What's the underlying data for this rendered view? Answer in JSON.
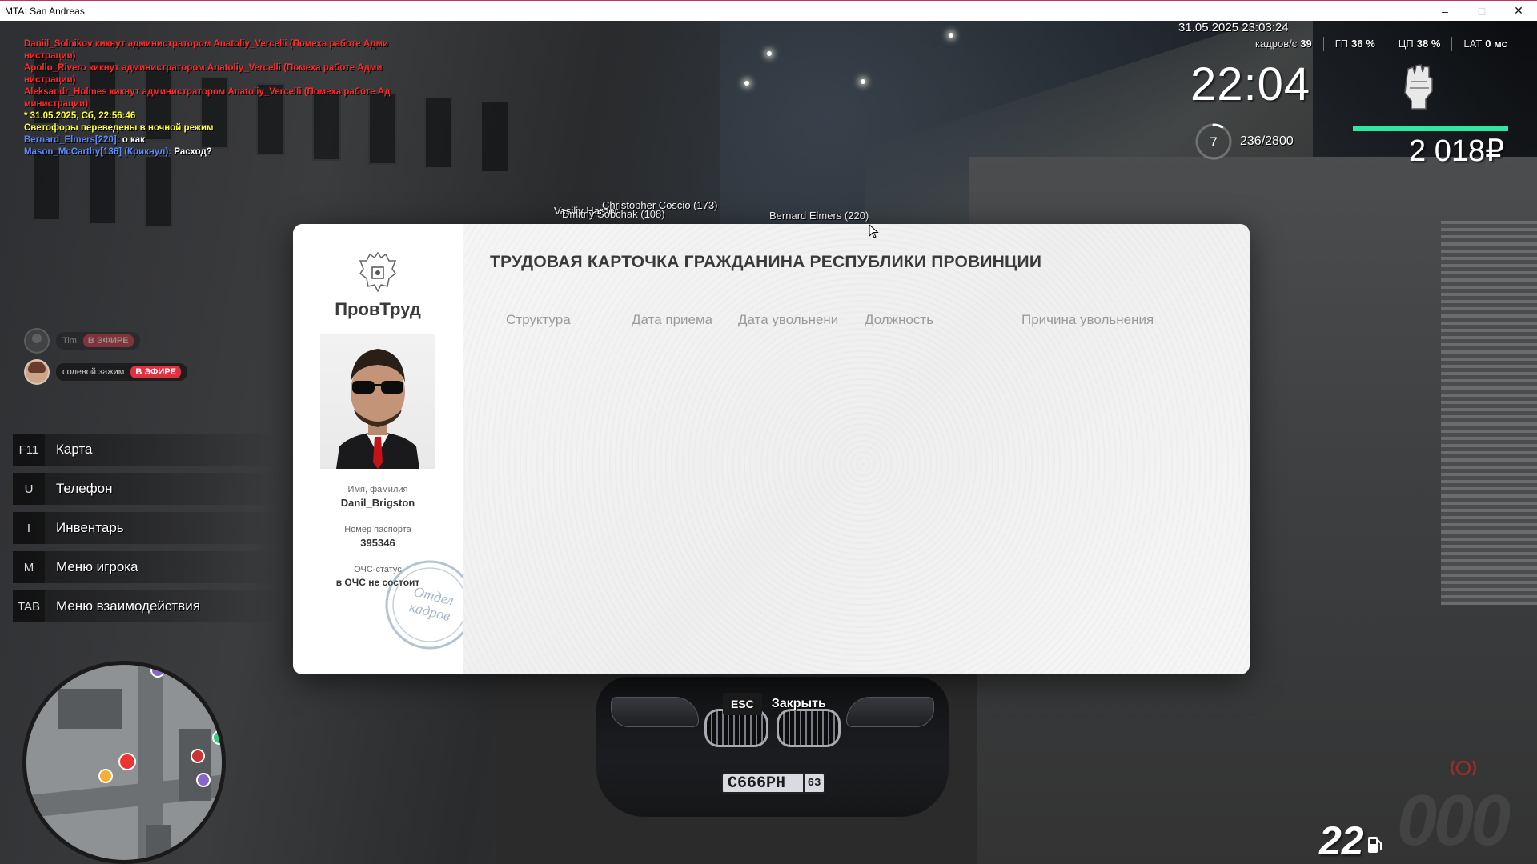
{
  "window": {
    "title": "MTA: San Andreas",
    "minimize": "–",
    "maximize": "□",
    "close": "✕"
  },
  "chat": [
    {
      "color": "red",
      "text": "Daniil_Solnikov кикнут администратором Anatoliy_Vercelli (Помеха работе Адми нистрации)"
    },
    {
      "color": "red",
      "text": "Apollo_Rivero кикнут администратором Anatoliy_Vercelli (Помеха работе Адми нистрации)"
    },
    {
      "color": "red",
      "text": "Aleksandr_Holmes кикнут администратором Anatoliy_Vercelli (Помеха работе Ад министрации)"
    },
    {
      "color": "yellow",
      "text": "* 31.05.2025, Сб, 22:56:46"
    },
    {
      "color": "yellow",
      "text": "Светофоры переведены в ночной режим"
    },
    {
      "color": "blue",
      "text": "Bernard_Elmers[220]:",
      "rest": " о как"
    },
    {
      "color": "blue",
      "text": "Mason_McCarthy[136] (Крикнул):",
      "rest": " Расход?"
    }
  ],
  "hud": {
    "datetime": "31.05.2025 23:03:24",
    "fps_label": "кадров/с",
    "fps": "39",
    "gpu_label": "ГП",
    "gpu": "36 %",
    "cpu_label": "ЦП",
    "cpu": "38 %",
    "lat_label": "LAT",
    "lat": "0 мс",
    "clock": "22:04",
    "level": "7",
    "xp": "236/2800",
    "xp_fraction": 0.084,
    "health_fraction": 1.0,
    "money": "2 018₽",
    "accent": "#2ee8a0"
  },
  "nametags": [
    {
      "text": "Christopher Coscio (173)"
    },
    {
      "text": "Vasiliy Harper"
    },
    {
      "text": "Dmitriy Sobchak (108)"
    },
    {
      "text": "Bernard Elmers (220)"
    }
  ],
  "voice": [
    {
      "name": "Tim",
      "live": "В ЭФИРЕ"
    },
    {
      "name": "солевой зажим",
      "live": "В ЭФИРЕ"
    }
  ],
  "hotkeys": [
    {
      "key": "F11",
      "label": "Карта"
    },
    {
      "key": "U",
      "label": "Телефон"
    },
    {
      "key": "I",
      "label": "Инвентарь"
    },
    {
      "key": "M",
      "label": "Меню игрока"
    },
    {
      "key": "TAB",
      "label": "Меню взаимодействия"
    }
  ],
  "vehicle": {
    "plate": "С666РН",
    "region": "63",
    "fuel": "22",
    "speed": "000"
  },
  "card": {
    "brand": "ПровТруд",
    "title": "ТРУДОВАЯ КАРТОЧКА ГРАЖДАНИНА РЕСПУБЛИКИ ПРОВИНЦИИ",
    "columns": [
      "Структура",
      "Дата приема",
      "Дата увольнени",
      "Должность",
      "Причина увольнения"
    ],
    "name_label": "Имя, фамилия",
    "name_value": "Danil_Brigston",
    "passport_label": "Номер паспорта",
    "passport_value": "395346",
    "status_label": "ОЧС-статус",
    "status_value": "в ОЧС не состоит",
    "stamp_line1": "Отдел",
    "stamp_line2": "кадров"
  },
  "close_hint": {
    "key": "ESC",
    "label": "Закрыть"
  }
}
